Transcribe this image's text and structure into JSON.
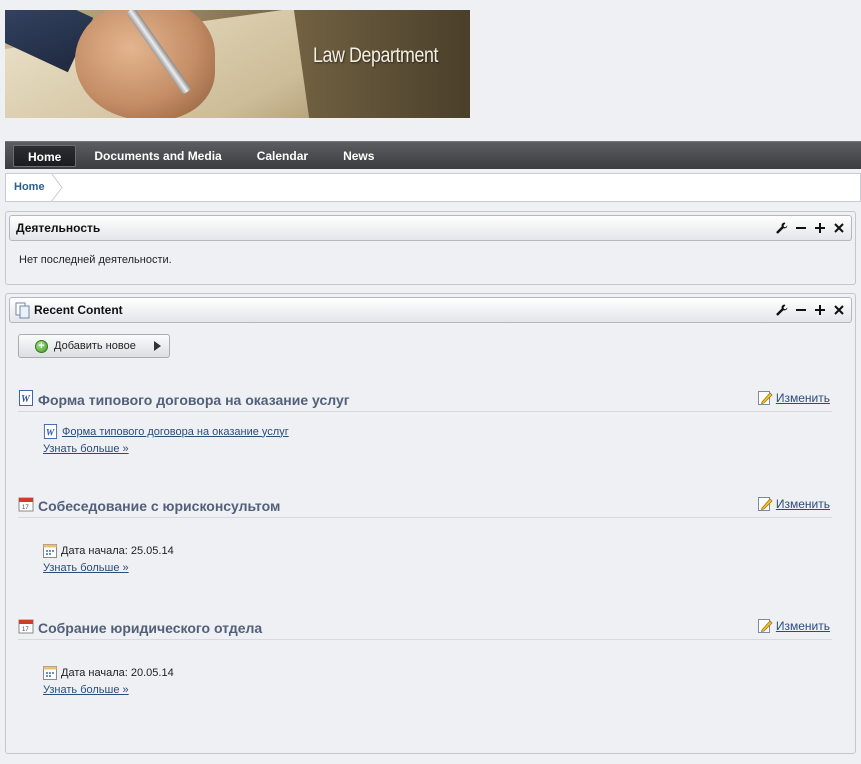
{
  "banner": {
    "title": "Law Department"
  },
  "nav": {
    "items": [
      {
        "label": "Home",
        "active": true
      },
      {
        "label": "Documents and Media"
      },
      {
        "label": "Calendar"
      },
      {
        "label": "News"
      }
    ]
  },
  "breadcrumb": {
    "items": [
      "Home"
    ]
  },
  "activity_portlet": {
    "title": "Деятельность",
    "empty_message": "Нет последней деятельности."
  },
  "recent_portlet": {
    "title": "Recent Content",
    "add_button": "Добавить новое",
    "edit_label": "Изменить",
    "entries": [
      {
        "title": "Форма типового договора на оказание услуг",
        "type": "document",
        "file_link": "Форма типового договора на оказание услуг",
        "more": "Узнать больше »"
      },
      {
        "title": "Собеседование с юрисконсультом",
        "type": "event",
        "date_label": "Дата начала: 25.05.14",
        "more": "Узнать больше »"
      },
      {
        "title": "Собрание юридического отдела",
        "type": "event",
        "date_label": "Дата начала: 20.05.14",
        "more": "Узнать больше »"
      }
    ]
  },
  "colors": {
    "nav_bg": "#3b3d40",
    "link": "#2d4c7a",
    "entry_title": "#52607a",
    "page_bg": "#eef0f3"
  }
}
